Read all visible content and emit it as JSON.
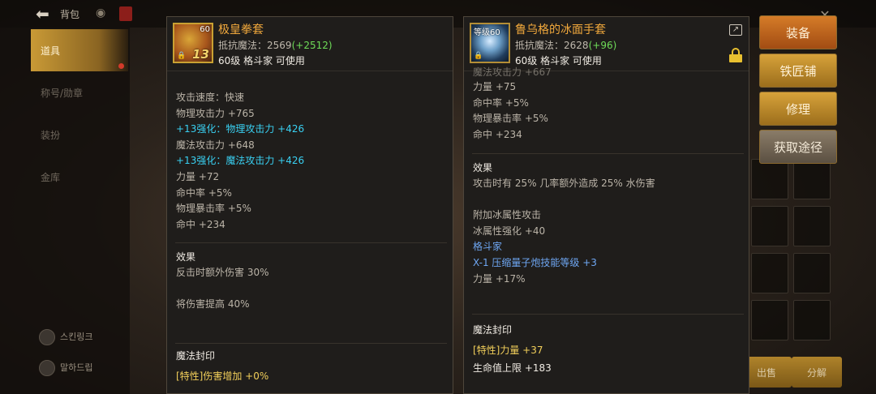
{
  "topbar": {
    "title": "背包",
    "back_icon": "back-arrow-icon",
    "close_icon": "close-icon"
  },
  "sidebar": {
    "tabs": [
      {
        "label": "道具",
        "active": true
      },
      {
        "label": "称号/勋章",
        "active": false
      },
      {
        "label": "装扮",
        "active": false
      },
      {
        "label": "金库",
        "active": false
      }
    ],
    "footer": [
      {
        "label": "스킨링크"
      },
      {
        "label": "말하드립"
      }
    ]
  },
  "actions": {
    "equip": "装备",
    "smith": "铁匠铺",
    "repair": "修理",
    "source": "获取途径",
    "sell": "出售",
    "disassemble": "分解"
  },
  "left_item": {
    "name": "极皇拳套",
    "icon_level": "60",
    "icon_plus": "13",
    "resist_label": "抵抗魔法",
    "resist_base": "2569",
    "resist_bonus": "(+2512)",
    "requirement": "60级 格斗家 可使用",
    "stats": [
      {
        "text": "攻击速度：快速",
        "style": "normal"
      },
      {
        "text": "物理攻击力 +765",
        "style": "normal"
      },
      {
        "text": "+13强化：物理攻击力 +426",
        "style": "cyan"
      },
      {
        "text": "魔法攻击力 +648",
        "style": "normal"
      },
      {
        "text": "+13强化：魔法攻击力 +426",
        "style": "cyan"
      },
      {
        "text": "力量 +72",
        "style": "normal"
      },
      {
        "text": "命中率 +5%",
        "style": "normal"
      },
      {
        "text": "物理暴击率 +5%",
        "style": "normal"
      },
      {
        "text": "命中 +234",
        "style": "normal"
      }
    ],
    "effect_title": "效果",
    "effects": [
      "反击时额外伤害 30%",
      "",
      "将伤害提高 40%"
    ],
    "seal_title": "魔法封印",
    "seal_partial": "[特性]伤害增加 +0%"
  },
  "right_item": {
    "name": "鲁乌格的冰面手套",
    "icon_level_label": "等级60",
    "resist_label": "抵抗魔法",
    "resist_base": "2628",
    "resist_bonus": "(+96)",
    "requirement": "60级 格斗家 可使用",
    "stats_partial": "魔法攻击力 +667",
    "stats": [
      {
        "text": "力量 +75",
        "style": "normal"
      },
      {
        "text": "命中率 +5%",
        "style": "normal"
      },
      {
        "text": "物理暴击率 +5%",
        "style": "normal"
      },
      {
        "text": "命中 +234",
        "style": "normal"
      }
    ],
    "effect_title": "效果",
    "effects": [
      {
        "text": "攻击时有 25% 几率额外造成 25% 水伤害",
        "style": "normal"
      },
      {
        "text": "",
        "style": "normal"
      },
      {
        "text": "附加冰属性攻击",
        "style": "normal"
      },
      {
        "text": "冰属性强化 +40",
        "style": "normal"
      },
      {
        "text": "格斗家",
        "style": "blue"
      },
      {
        "text": "X-1 压缩量子炮技能等级 +3",
        "style": "blue"
      },
      {
        "text": "力量 +17%",
        "style": "normal"
      }
    ],
    "seal_title": "魔法封印",
    "seal": [
      {
        "text": "[特性]力量 +37",
        "style": "yellow"
      },
      {
        "text": "生命值上限 +183",
        "style": "white"
      }
    ]
  },
  "colors": {
    "item_name": "#f2a93c",
    "bonus_green": "#6edc58",
    "reinforce_cyan": "#39d0f2",
    "class_blue": "#6ea6f2",
    "seal_yellow": "#f2cf5a"
  }
}
